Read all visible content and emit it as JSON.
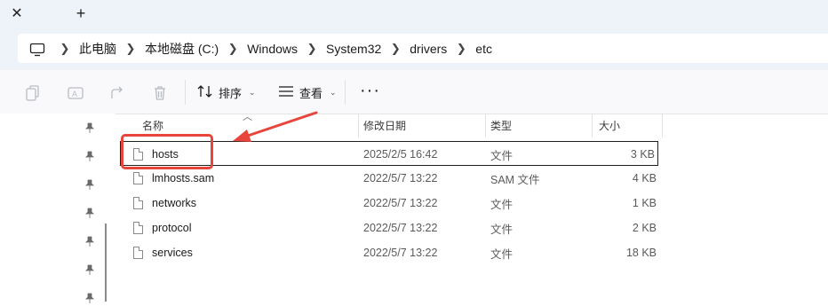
{
  "tabs": {
    "close_glyph": "✕",
    "new_glyph": "+"
  },
  "address": {
    "crumbs": [
      "此电脑",
      "本地磁盘 (C:)",
      "Windows",
      "System32",
      "drivers",
      "etc"
    ]
  },
  "toolbar": {
    "sort_label": "排序",
    "view_label": "查看",
    "more_label": "···"
  },
  "columns": {
    "name": "名称",
    "modified": "修改日期",
    "type": "类型",
    "size": "大小"
  },
  "files": [
    {
      "name": "hosts",
      "modified": "2025/2/5 16:42",
      "type": "文件",
      "size": "3 KB",
      "selected": true
    },
    {
      "name": "lmhosts.sam",
      "modified": "2022/5/7 13:22",
      "type": "SAM 文件",
      "size": "4 KB"
    },
    {
      "name": "networks",
      "modified": "2022/5/7 13:22",
      "type": "文件",
      "size": "1 KB"
    },
    {
      "name": "protocol",
      "modified": "2022/5/7 13:22",
      "type": "文件",
      "size": "2 KB"
    },
    {
      "name": "services",
      "modified": "2022/5/7 13:22",
      "type": "文件",
      "size": "18 KB"
    }
  ],
  "colors": {
    "annotation": "#e8453c",
    "chrome": "#eef2f9"
  }
}
